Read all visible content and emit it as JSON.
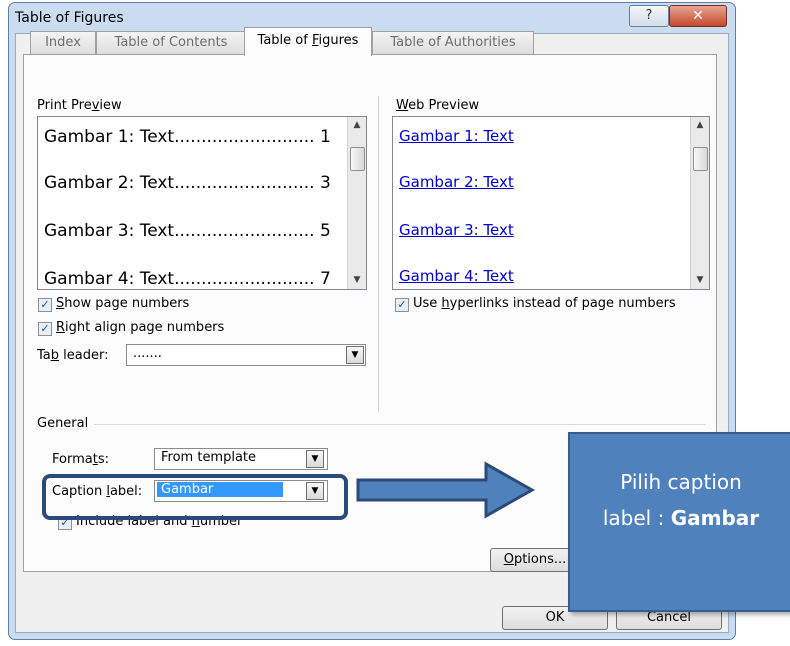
{
  "window": {
    "title": "Table of Figures",
    "help_glyph": "?",
    "close_glyph": "✕"
  },
  "tabs": [
    {
      "label_pre": "Index",
      "label_u": "",
      "label_post": ""
    },
    {
      "label_pre": "Table of Contents",
      "label_u": "",
      "label_post": ""
    },
    {
      "label_pre": "Table of ",
      "label_u": "F",
      "label_post": "igures"
    },
    {
      "label_pre": "Table of Authorities",
      "label_u": "",
      "label_post": ""
    }
  ],
  "print_preview": {
    "label_pre": "Print Pre",
    "label_u": "v",
    "label_post": "iew",
    "items": [
      "Gambar 1: Text.......................... 1",
      "Gambar 2: Text.......................... 3",
      "Gambar 3: Text.......................... 5",
      "Gambar 4: Text.......................... 7"
    ]
  },
  "web_preview": {
    "label_u": "W",
    "label_post": "eb Preview",
    "items": [
      "Gambar 1: Text",
      "Gambar 2: Text",
      "Gambar 3: Text",
      "Gambar 4: Text"
    ]
  },
  "options": {
    "show_page_numbers": {
      "u": "S",
      "post": "how page numbers",
      "checked": true
    },
    "right_align": {
      "u": "R",
      "post": "ight align page numbers",
      "checked": true
    },
    "use_hyperlinks": {
      "pre": "Use ",
      "u": "h",
      "post": "yperlinks instead of page numbers",
      "checked": true
    },
    "tab_leader": {
      "pre": "Ta",
      "u": "b",
      "post": " leader:",
      "value": "......."
    }
  },
  "general": {
    "label": "General",
    "formats": {
      "pre": "Forma",
      "u": "t",
      "post": "s:",
      "value": "From template"
    },
    "caption_label": {
      "pre": "Caption ",
      "u": "l",
      "post": "abel:",
      "value": "Gambar"
    },
    "include_label": {
      "pre": "Include label and ",
      "u": "n",
      "post": "umber",
      "checked": true
    }
  },
  "buttons": {
    "options_u": "O",
    "options_post": "ptions...",
    "ok": "OK",
    "cancel": "Cancel"
  },
  "callout": {
    "line1": "Pilih caption",
    "line2_pre": "label : ",
    "line2_bold": "Gambar"
  },
  "colors": {
    "accent": "#4f81bd",
    "highlight_border": "#2c4a78",
    "link": "#0000cc"
  }
}
